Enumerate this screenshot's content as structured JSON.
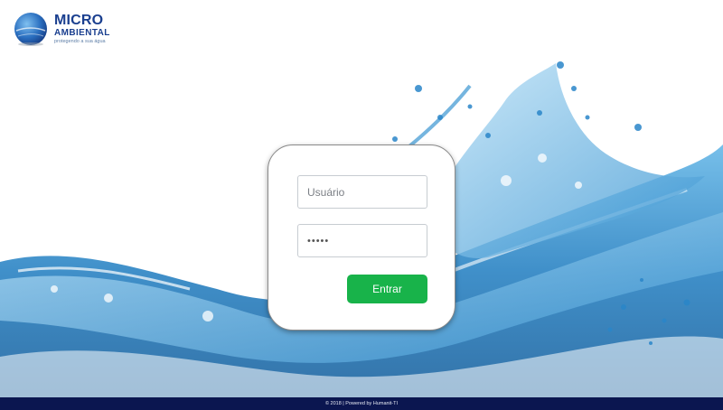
{
  "logo": {
    "line1": "MICRO",
    "line2": "AMBIENTAL",
    "tagline": "protegendo a sua água"
  },
  "login": {
    "username_placeholder": "Usuário",
    "username_value": "",
    "password_value": "•••••",
    "submit_label": "Entrar"
  },
  "footer": {
    "text": "© 2018 | Powered by Humanit-TI"
  },
  "colors": {
    "brand_blue": "#1a3f8f",
    "button_green": "#18b34a",
    "footer_navy": "#0b1650",
    "water_blue": "#1d7fc0"
  }
}
